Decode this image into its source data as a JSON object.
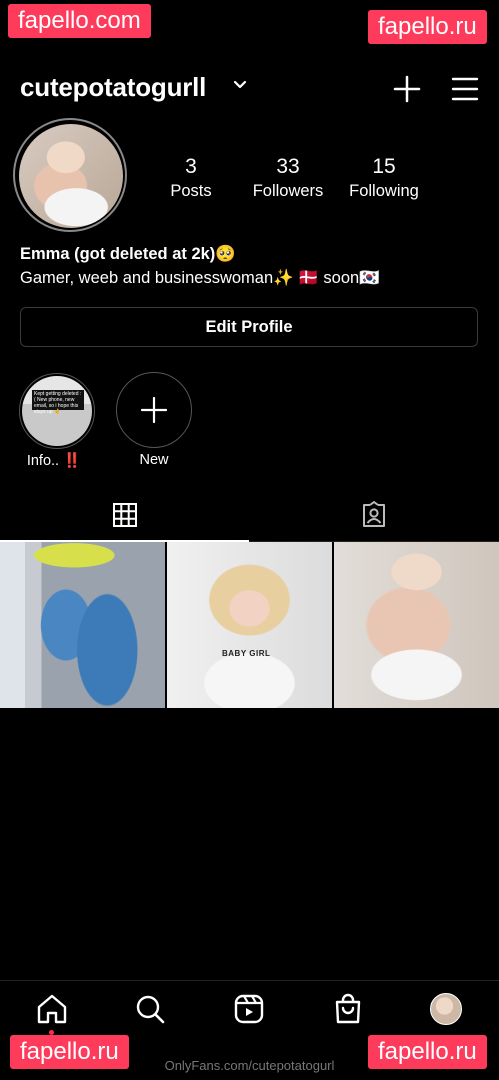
{
  "watermarks": {
    "top_left": "fapello.com",
    "top_right": "fapello.ru",
    "bottom_left": "fapello.ru",
    "bottom_right": "fapello.ru",
    "footer": "OnlyFans.com/cutepotatogurl"
  },
  "header": {
    "username": "cutepotatogurll",
    "icons": [
      "chevron-down-icon",
      "plus-icon",
      "hamburger-menu-icon"
    ]
  },
  "stats": [
    {
      "value": "3",
      "label": "Posts"
    },
    {
      "value": "33",
      "label": "Followers"
    },
    {
      "value": "15",
      "label": "Following"
    }
  ],
  "bio": {
    "name": "Emma (got deleted at 2k)🥺",
    "text": "Gamer, weeb and businesswoman✨  🇩🇰 soon🇰🇷"
  },
  "edit_profile_label": "Edit Profile",
  "highlights": [
    {
      "label": "Info.. ‼️",
      "note": "Kept getting deleted :( New phone, new email, so i hope this stays up 🤞"
    },
    {
      "label": "New"
    }
  ],
  "tabs": [
    "grid-icon",
    "tagged-icon"
  ],
  "posts": [
    {
      "tee_text": ""
    },
    {
      "tee_text": "BABY GIRL"
    },
    {
      "tee_text": ""
    }
  ],
  "bottom_nav": [
    "home-icon",
    "search-icon",
    "reels-icon",
    "shop-icon",
    "profile-avatar"
  ],
  "colors": {
    "background": "#000000",
    "text": "#ffffff",
    "watermark": "#ff3b5c",
    "notification_dot": "#ff3040"
  }
}
